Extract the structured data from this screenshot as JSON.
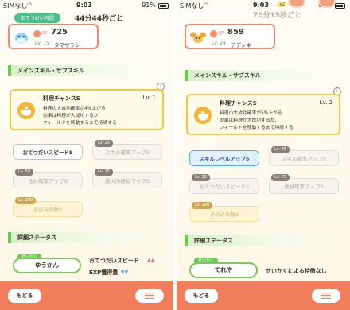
{
  "status_bar": {
    "carrier": "SIMなし",
    "time": "9:03",
    "battery": "91%"
  },
  "left": {
    "tag": "おてつだい時間",
    "time_label": "44分44秒ごと",
    "helper": {
      "sp_label": "SP",
      "sp": "725",
      "level": "Lv. 15",
      "name": "タマザラシ"
    },
    "sections": {
      "skills": "メインスキル・サブスキル",
      "details": "詳細ステータス"
    },
    "main_skill": {
      "name": "料理チャンスS",
      "level": "Lv. 1",
      "description": "料理の大成功確率が4%上がる\n効果は料理が大成功するか、\nフィールドを移動するまで持続する"
    },
    "subskills": [
      {
        "label": "おてつだいスピードS",
        "tag": ""
      },
      {
        "label": "スキル確率アップS",
        "tag": "Lv. 25"
      },
      {
        "label": "食材確率アップS",
        "tag": "Lv. 50"
      },
      {
        "label": "最大所持数アップS",
        "tag": "Lv. 75"
      },
      {
        "label": "きのみの数S",
        "tag": "Lv. 100"
      }
    ],
    "nature": {
      "tag": "せいかく",
      "value": "ゆうかん"
    },
    "effects": [
      {
        "label": "おてつだいスピード",
        "direction": "up"
      },
      {
        "label": "EXP獲得量",
        "direction": "down"
      }
    ],
    "buttons": {
      "back": "もどる"
    }
  },
  "right": {
    "multiplier": "x2",
    "time_label": "70分15秒ごと",
    "helper": {
      "sp_label": "SP",
      "sp": "859",
      "level": "Lv. 24",
      "name": "デデンネ"
    },
    "sections": {
      "skills": "メインスキル・サブスキル",
      "details": "詳細ステータス"
    },
    "main_skill": {
      "name": "料理チャンスS",
      "level": "Lv. 2",
      "description": "料理の大成功確率が5%上がる\n効果は料理が大成功するか、\nフィールドを移動するまで持続する"
    },
    "subskills": [
      {
        "label": "スキルレベルアップS",
        "tag": ""
      },
      {
        "label": "スキル確率アップS",
        "tag": "Lv. 25"
      },
      {
        "label": "おてつだいスピードS",
        "tag": "Lv. 50"
      },
      {
        "label": "食材確率アップS",
        "tag": "Lv. 75"
      },
      {
        "label": "きのみの数S",
        "tag": "Lv. 100"
      }
    ],
    "nature": {
      "tag": "せいかく",
      "value": "てれや"
    },
    "nature_note": "せいかくによる特徴なし",
    "buttons": {
      "back": "もどる"
    }
  },
  "colors": {
    "accent": "#f27d5a",
    "green": "#6cc84d",
    "skill_border": "#f2c84a",
    "selected_chip": "#5aa8e8"
  }
}
